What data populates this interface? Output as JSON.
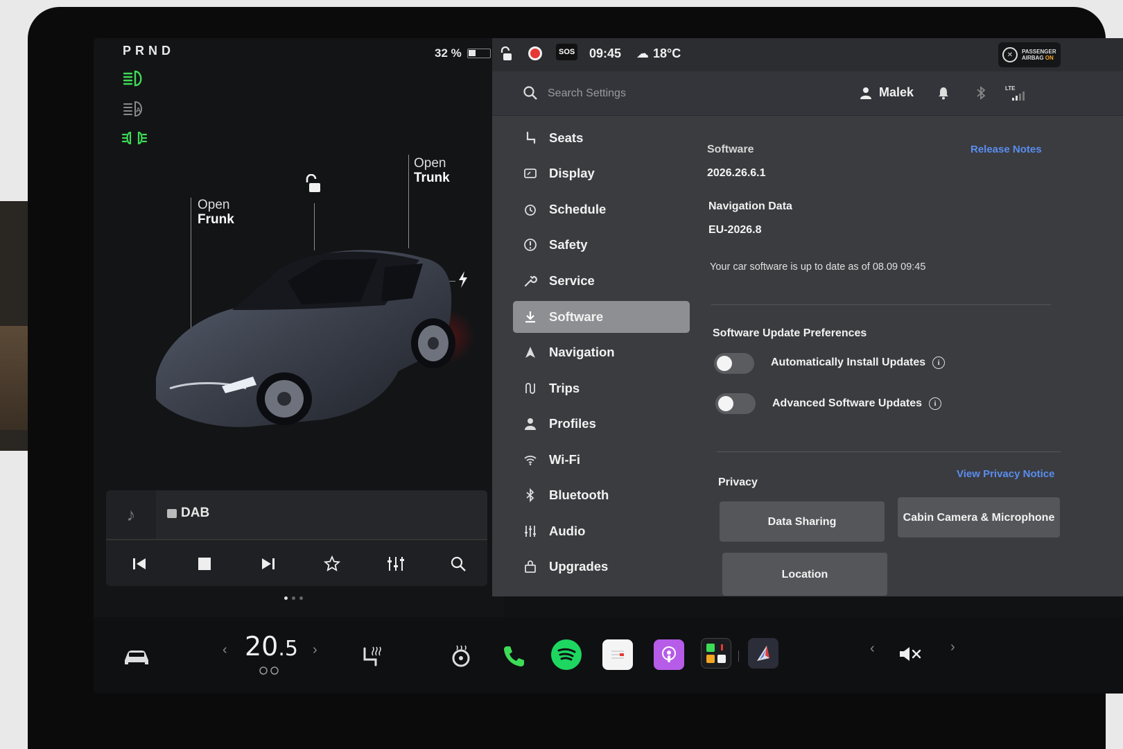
{
  "car": {
    "gear": "PRND",
    "battery_percent": "32 %",
    "battery_level": 0.32,
    "frunk_label_1": "Open",
    "frunk_label_2": "Frunk",
    "trunk_label_1": "Open",
    "trunk_label_2": "Trunk"
  },
  "media": {
    "source": "DAB"
  },
  "status_bar": {
    "sos": "SOS",
    "time": "09:45",
    "temperature": "18°C",
    "airbag_line1": "PASSENGER",
    "airbag_line2": "AIRBAG",
    "airbag_state": "ON"
  },
  "header": {
    "search_placeholder": "Search Settings",
    "user_name": "Malek",
    "lte": "LTE"
  },
  "nav": {
    "items": [
      {
        "label": "Seats",
        "icon": "seat-icon"
      },
      {
        "label": "Display",
        "icon": "display-icon"
      },
      {
        "label": "Schedule",
        "icon": "clock-icon"
      },
      {
        "label": "Safety",
        "icon": "alert-circle-icon"
      },
      {
        "label": "Service",
        "icon": "wrench-icon"
      },
      {
        "label": "Software",
        "icon": "download-icon"
      },
      {
        "label": "Navigation",
        "icon": "navigation-icon"
      },
      {
        "label": "Trips",
        "icon": "trips-icon"
      },
      {
        "label": "Profiles",
        "icon": "person-icon"
      },
      {
        "label": "Wi-Fi",
        "icon": "wifi-icon"
      },
      {
        "label": "Bluetooth",
        "icon": "bluetooth-icon"
      },
      {
        "label": "Audio",
        "icon": "equalizer-icon"
      },
      {
        "label": "Upgrades",
        "icon": "bag-icon"
      }
    ],
    "active": "Software"
  },
  "software": {
    "section_label": "Software",
    "release_notes": "Release Notes",
    "version": "2026.26.6.1",
    "nav_data_label": "Navigation Data",
    "nav_data_value": "EU-2026.8",
    "status_text": "Your car software is up to date as of 08.09 09:45",
    "prefs_heading": "Software Update Preferences",
    "auto_install_label": "Automatically Install Updates",
    "advanced_label": "Advanced Software Updates",
    "privacy_heading": "Privacy",
    "privacy_link": "View Privacy Notice",
    "btn_data_sharing": "Data Sharing",
    "btn_cabin_camera": "Cabin Camera & Microphone",
    "btn_location": "Location"
  },
  "dock": {
    "temp_whole": "20",
    "temp_decimal": ".5"
  },
  "colors": {
    "accent_link": "#5a8dee",
    "lamp_green": "#3ddc56",
    "record_red": "#e53935",
    "spotify_green": "#1ed760",
    "podcast_purple": "#b65ce8"
  }
}
